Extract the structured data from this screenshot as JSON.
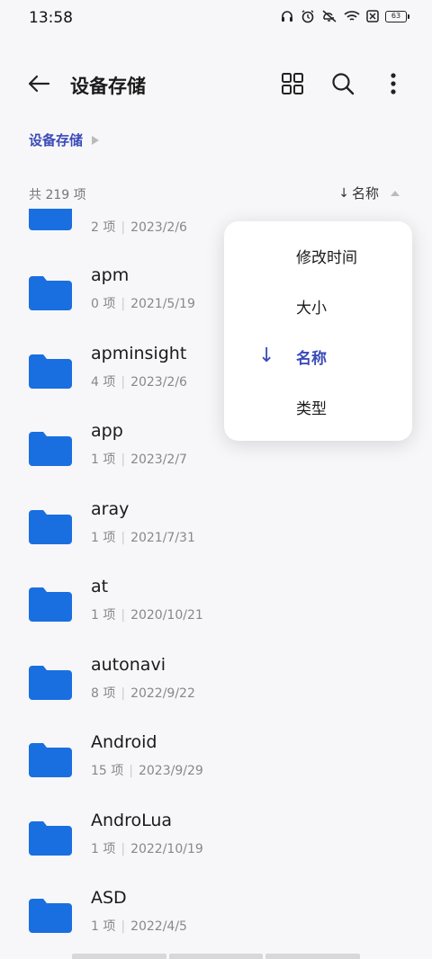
{
  "status_bar": {
    "time": "13:58",
    "battery": "63",
    "icons": [
      "headphones-icon",
      "alarm-icon",
      "mute-icon",
      "wifi-icon",
      "sim-off-icon",
      "battery-icon"
    ]
  },
  "toolbar": {
    "title": "设备存储",
    "icons": [
      "back-arrow-icon",
      "grid-view-icon",
      "search-icon",
      "more-vert-icon"
    ]
  },
  "breadcrumb": {
    "label": "设备存储"
  },
  "summary": {
    "count_label": "共 219 项",
    "sort_label": "名称"
  },
  "partial_item": {
    "count": "2 项",
    "date": "2023/2/6"
  },
  "files": [
    {
      "name": "apm",
      "count": "0 项",
      "date": "2021/5/19"
    },
    {
      "name": "apminsight",
      "count": "4 项",
      "date": "2023/2/6"
    },
    {
      "name": "app",
      "count": "1 项",
      "date": "2023/2/7"
    },
    {
      "name": "aray",
      "count": "1 项",
      "date": "2021/7/31"
    },
    {
      "name": "at",
      "count": "1 项",
      "date": "2020/10/21"
    },
    {
      "name": "autonavi",
      "count": "8 项",
      "date": "2022/9/22"
    },
    {
      "name": "Android",
      "count": "15 项",
      "date": "2023/9/29"
    },
    {
      "name": "AndroLua",
      "count": "1 项",
      "date": "2022/10/19"
    },
    {
      "name": "ASD",
      "count": "1 项",
      "date": "2022/4/5"
    }
  ],
  "sort_menu": {
    "items": [
      {
        "label": "修改时间",
        "selected": false
      },
      {
        "label": "大小",
        "selected": false
      },
      {
        "label": "名称",
        "selected": true
      },
      {
        "label": "类型",
        "selected": false
      }
    ]
  },
  "colors": {
    "accent": "#3a4bb8",
    "folder": "#1a6fe0",
    "background": "#f7f7f9"
  }
}
